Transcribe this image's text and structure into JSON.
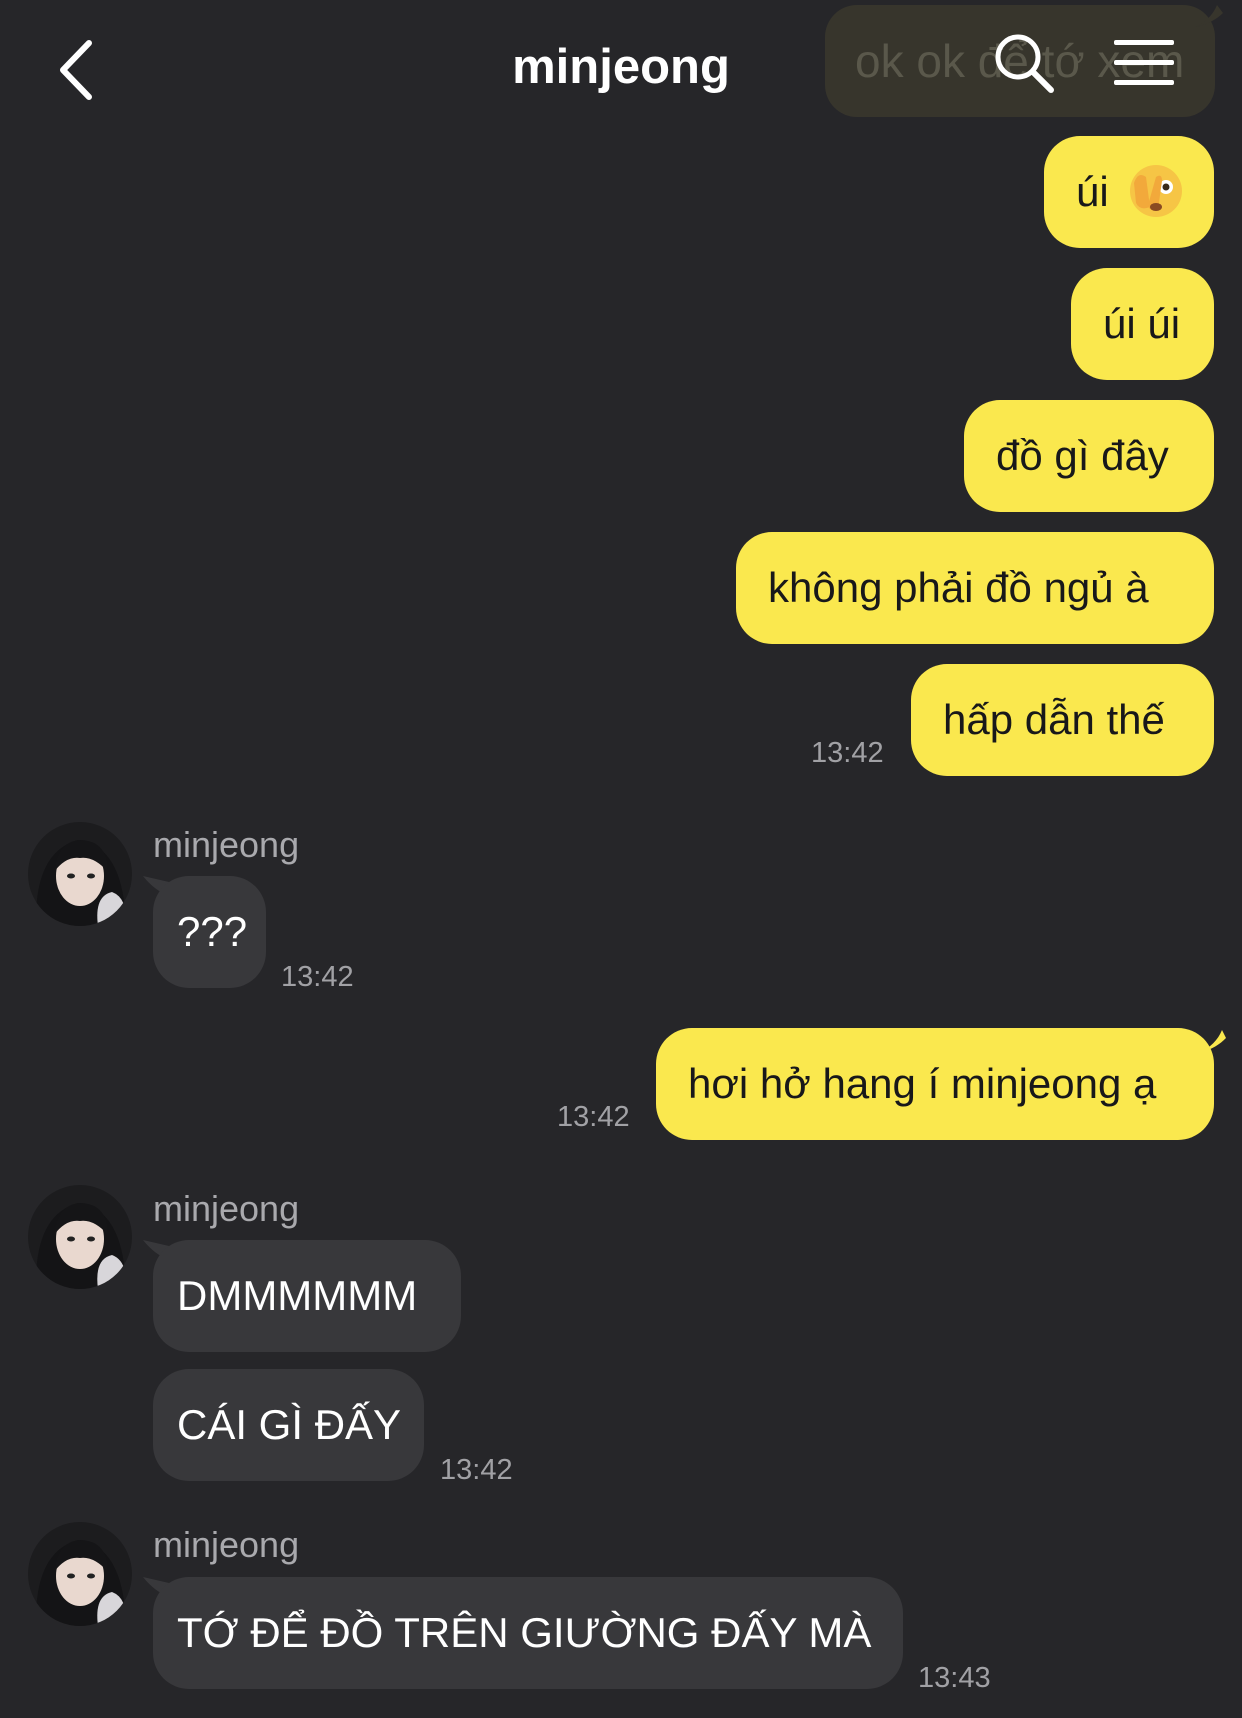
{
  "header": {
    "title": "minjeong",
    "ghost_preview": "ok ok để tớ xem"
  },
  "messages": [
    {
      "from": "me",
      "text": "úi",
      "emoji": "face-peeking-icon"
    },
    {
      "from": "me",
      "text": "úi úi"
    },
    {
      "from": "me",
      "text": "đồ gì đây"
    },
    {
      "from": "me",
      "text": "không phải đồ ngủ à"
    },
    {
      "from": "me",
      "text": "hấp dẫn thế",
      "time": "13:42"
    },
    {
      "from": "them",
      "sender": "minjeong",
      "text": "???",
      "time": "13:42"
    },
    {
      "from": "me",
      "text": "hơi hở hang í minjeong ạ",
      "time": "13:42"
    },
    {
      "from": "them",
      "sender": "minjeong",
      "text": "DMMMMMM"
    },
    {
      "from": "them",
      "text": "CÁI GÌ ĐẤY",
      "time": "13:42"
    },
    {
      "from": "them",
      "sender": "minjeong",
      "text": "TỚ ĐỂ ĐỒ TRÊN GIƯỜNG ĐẤY MÀ",
      "time": "13:43"
    }
  ],
  "colors": {
    "background": "#262629",
    "my_bubble": "#fae84e",
    "their_bubble": "#38383b",
    "timestamp": "#a1a1a5"
  }
}
